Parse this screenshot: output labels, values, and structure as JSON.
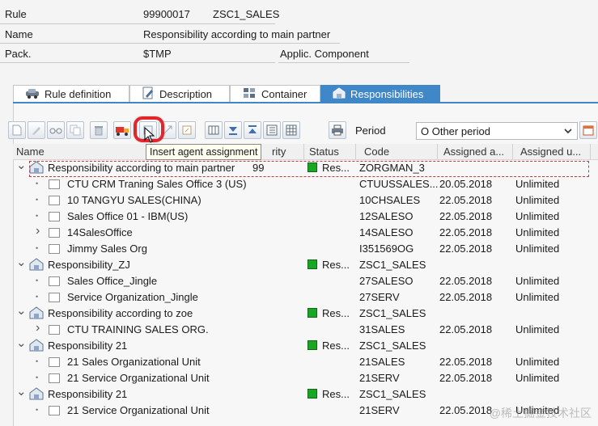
{
  "header": {
    "rule_label": "Rule",
    "rule_id": "99900017",
    "rule_code": "ZSC1_SALES",
    "name_label": "Name",
    "name_value": "Responsibility according to main partner",
    "pack_label": "Pack.",
    "pack_value": "$TMP",
    "applic_label": "Applic. Component"
  },
  "tabs": [
    {
      "label": "Rule definition",
      "icon": "car-icon"
    },
    {
      "label": "Description",
      "icon": "pencil-doc-icon"
    },
    {
      "label": "Container",
      "icon": "container-icon"
    },
    {
      "label": "Responsibilities",
      "icon": "responsibility-icon",
      "active": true
    }
  ],
  "toolbar": {
    "tooltip": "Insert agent assignment",
    "period_label": "Period",
    "period_value": "O Other period"
  },
  "columns": {
    "name": "Name",
    "priority_partial": "rity",
    "status": "Status",
    "code": "Code",
    "assigned_from": "Assigned a...",
    "assigned_until": "Assigned u..."
  },
  "rows": [
    {
      "level": 0,
      "expander": "down",
      "icon": "responsibility",
      "name": "Responsibility according to main partner",
      "priority": "99",
      "status": "Res...",
      "code": "ZORGMAN_3",
      "from": "",
      "until": ""
    },
    {
      "level": 1,
      "expander": "dot",
      "icon": "box",
      "name": "CTU CRM Traning Sales Office 3 (US)",
      "priority": "",
      "status": "",
      "code": "CTUUSSALES...",
      "from": "20.05.2018",
      "until": "Unlimited"
    },
    {
      "level": 1,
      "expander": "dot",
      "icon": "box",
      "name": "10 TANGYU SALES(CHINA)",
      "priority": "",
      "status": "",
      "code": "10CHSALES",
      "from": "22.05.2018",
      "until": "Unlimited"
    },
    {
      "level": 1,
      "expander": "dot",
      "icon": "box",
      "name": "Sales Office 01 - IBM(US)",
      "priority": "",
      "status": "",
      "code": "12SALESO",
      "from": "22.05.2018",
      "until": "Unlimited"
    },
    {
      "level": 1,
      "expander": "right",
      "icon": "box",
      "name": "14SalesOffice",
      "priority": "",
      "status": "",
      "code": "14SALESO",
      "from": "22.05.2018",
      "until": "Unlimited"
    },
    {
      "level": 1,
      "expander": "dot",
      "icon": "box",
      "name": "Jimmy Sales Org",
      "priority": "",
      "status": "",
      "code": "I351569OG",
      "from": "22.05.2018",
      "until": "Unlimited"
    },
    {
      "level": 0,
      "expander": "down",
      "icon": "responsibility",
      "name": "Responsibility_ZJ",
      "priority": "",
      "status": "Res...",
      "code": "ZSC1_SALES",
      "from": "",
      "until": ""
    },
    {
      "level": 1,
      "expander": "dot",
      "icon": "box",
      "name": "Sales Office_Jingle",
      "priority": "",
      "status": "",
      "code": "27SALESO",
      "from": "22.05.2018",
      "until": "Unlimited"
    },
    {
      "level": 1,
      "expander": "dot",
      "icon": "box",
      "name": "Service Organization_Jingle",
      "priority": "",
      "status": "",
      "code": "27SERV",
      "from": "22.05.2018",
      "until": "Unlimited"
    },
    {
      "level": 0,
      "expander": "down",
      "icon": "responsibility",
      "name": "Responsibility according to zoe",
      "priority": "",
      "status": "Res...",
      "code": "ZSC1_SALES",
      "from": "",
      "until": ""
    },
    {
      "level": 1,
      "expander": "right",
      "icon": "box",
      "name": "CTU TRAINING SALES ORG.",
      "priority": "",
      "status": "",
      "code": "31SALES",
      "from": "22.05.2018",
      "until": "Unlimited"
    },
    {
      "level": 0,
      "expander": "down",
      "icon": "responsibility",
      "name": "Responsibility 21",
      "priority": "",
      "status": "Res...",
      "code": "ZSC1_SALES",
      "from": "",
      "until": ""
    },
    {
      "level": 1,
      "expander": "dot",
      "icon": "box",
      "name": "21 Sales Organizational Unit",
      "priority": "",
      "status": "",
      "code": "21SALES",
      "from": "22.05.2018",
      "until": "Unlimited"
    },
    {
      "level": 1,
      "expander": "dot",
      "icon": "box",
      "name": "21 Service Organizational Unit",
      "priority": "",
      "status": "",
      "code": "21SERV",
      "from": "22.05.2018",
      "until": "Unlimited"
    },
    {
      "level": 0,
      "expander": "down",
      "icon": "responsibility",
      "name": "Responsibility 21",
      "priority": "",
      "status": "Res...",
      "code": "ZSC1_SALES",
      "from": "",
      "until": ""
    },
    {
      "level": 1,
      "expander": "dot",
      "icon": "box",
      "name": "21 Service Organizational Unit",
      "priority": "",
      "status": "",
      "code": "21SERV",
      "from": "22.05.2018",
      "until": "Unlimited"
    }
  ],
  "watermark": "@稀土掘金技术社区",
  "colors": {
    "accent": "#3f87c7",
    "status_green": "#19a624",
    "highlight_red": "#e2262b"
  }
}
